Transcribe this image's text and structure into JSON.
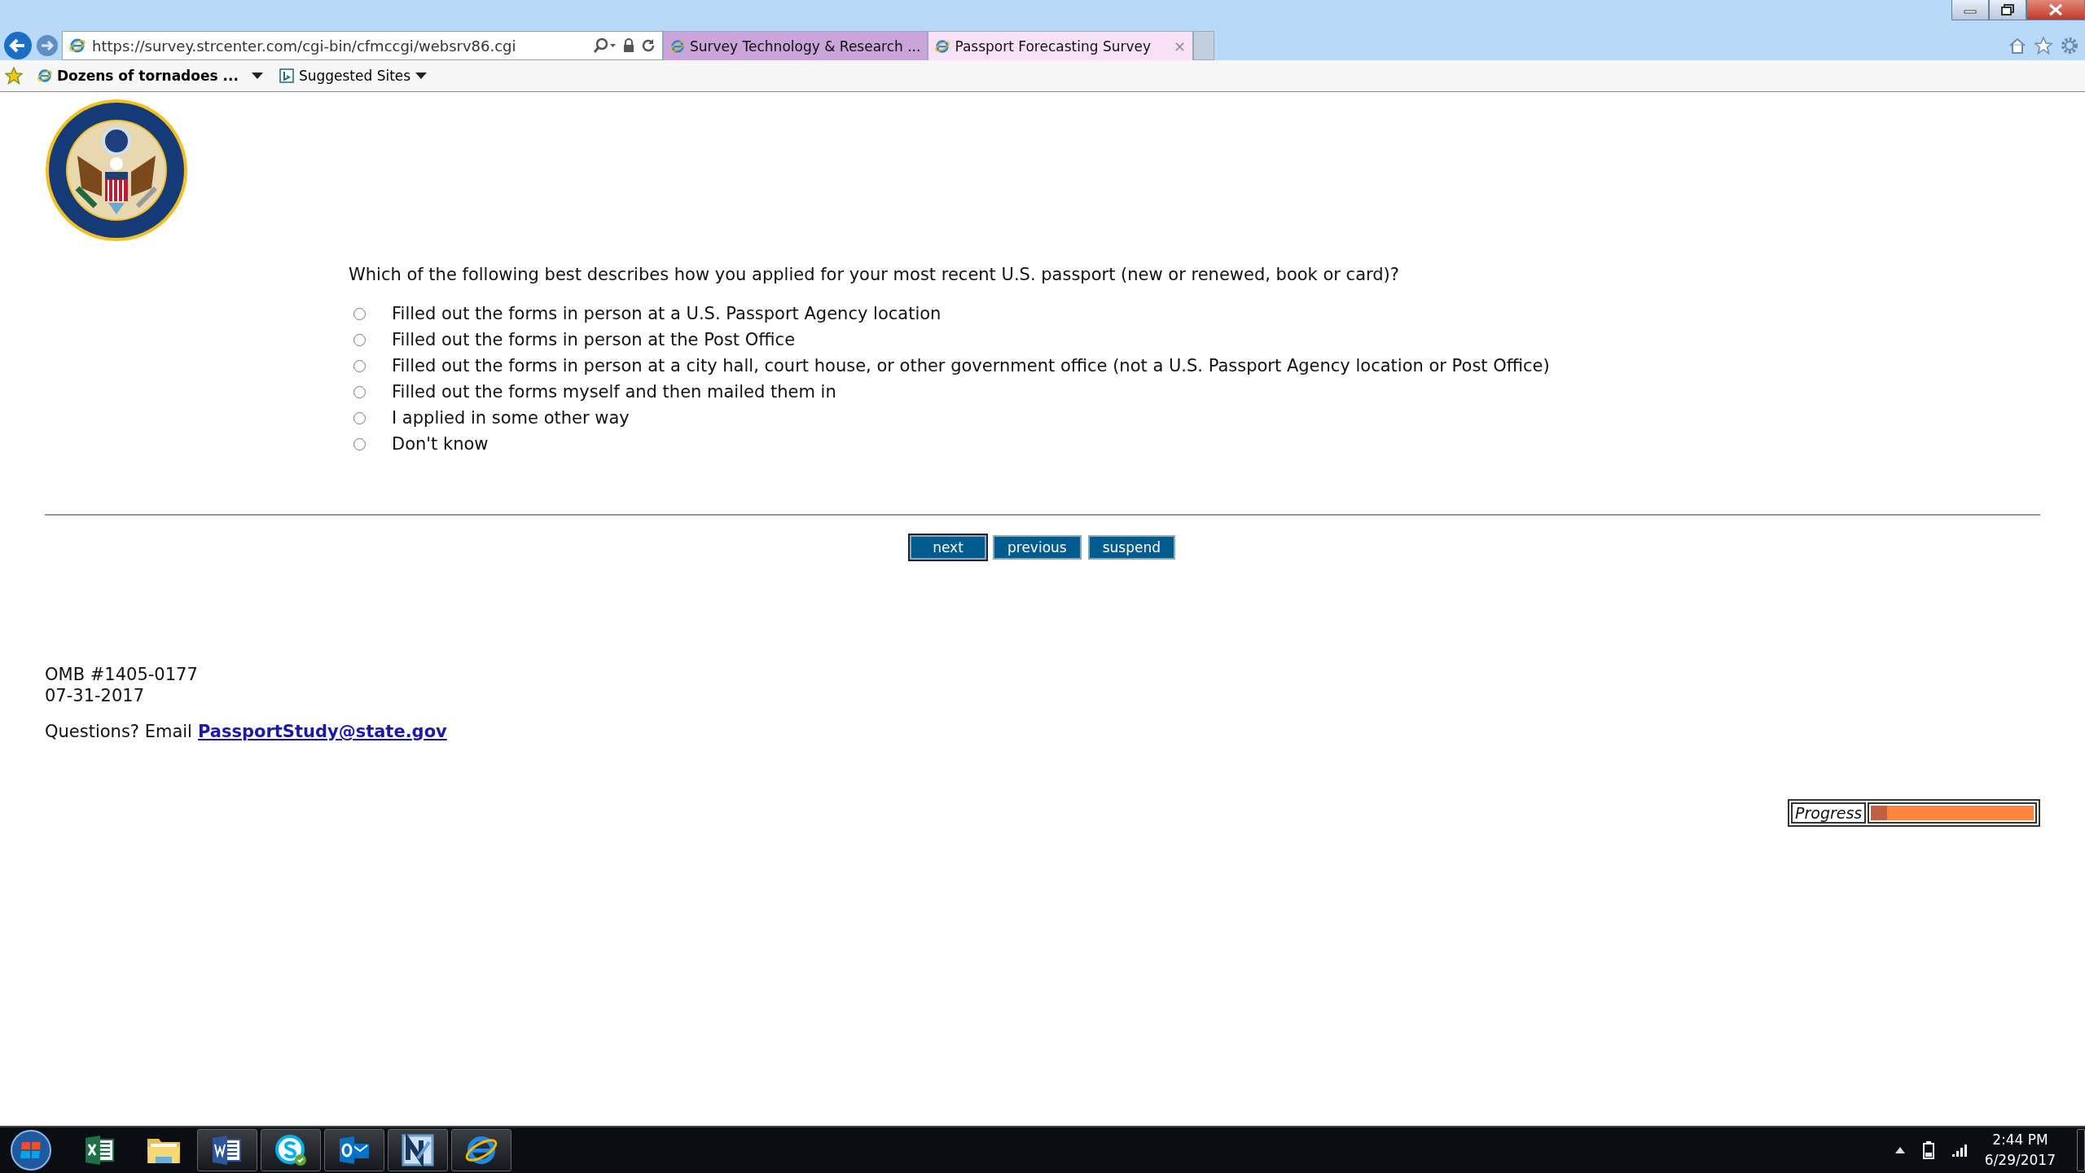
{
  "browser": {
    "address": "https://survey.strcenter.com/cgi-bin/cfmccgi/websrv86.cgi",
    "tabs": [
      {
        "title": "Survey Technology & Research ...",
        "selected": false
      },
      {
        "title": "Passport Forecasting Survey",
        "selected": true,
        "close": "×"
      }
    ],
    "favorites": [
      {
        "label": "Dozens of tornadoes ...",
        "kind": "feed"
      },
      {
        "label": "Suggested Sites",
        "kind": "sites"
      }
    ]
  },
  "survey": {
    "question": "Which of the following best describes how you applied for your most recent U.S. passport (new or renewed, book or card)?",
    "options": [
      {
        "label": "Filled out the forms in person at a U.S. Passport Agency location",
        "selected": false
      },
      {
        "label": "Filled out the forms in person at the Post Office",
        "selected": false
      },
      {
        "label": "Filled out the forms in person at a city hall, court house, or other government office (not a U.S. Passport Agency location or Post Office)",
        "selected": false
      },
      {
        "label": "Filled out the forms myself and then mailed them in",
        "selected": false
      },
      {
        "label": "I applied in some other way",
        "selected": false
      },
      {
        "label": "Don't know",
        "selected": false
      }
    ],
    "buttons": [
      {
        "label": "next",
        "focused": true
      },
      {
        "label": "previous",
        "focused": false
      },
      {
        "label": "suspend",
        "focused": false
      }
    ],
    "omb_number": "OMB #1405-0177",
    "omb_date": "07-31-2017",
    "contact": {
      "prefix": "Questions? Email",
      "link": "PassportStudy@state.gov"
    },
    "progress": {
      "label": "Progress",
      "level": 0.1
    }
  },
  "taskbar": {
    "apps": [
      {
        "kind": "excel",
        "running": false
      },
      {
        "kind": "folder",
        "running": false
      },
      {
        "kind": "word",
        "running": true
      },
      {
        "kind": "skype",
        "running": true
      },
      {
        "kind": "outlook",
        "running": true
      },
      {
        "kind": "n-app",
        "running": true
      },
      {
        "kind": "ie",
        "running": true
      }
    ],
    "time": "2:44 PM",
    "date": "6/29/2017"
  }
}
